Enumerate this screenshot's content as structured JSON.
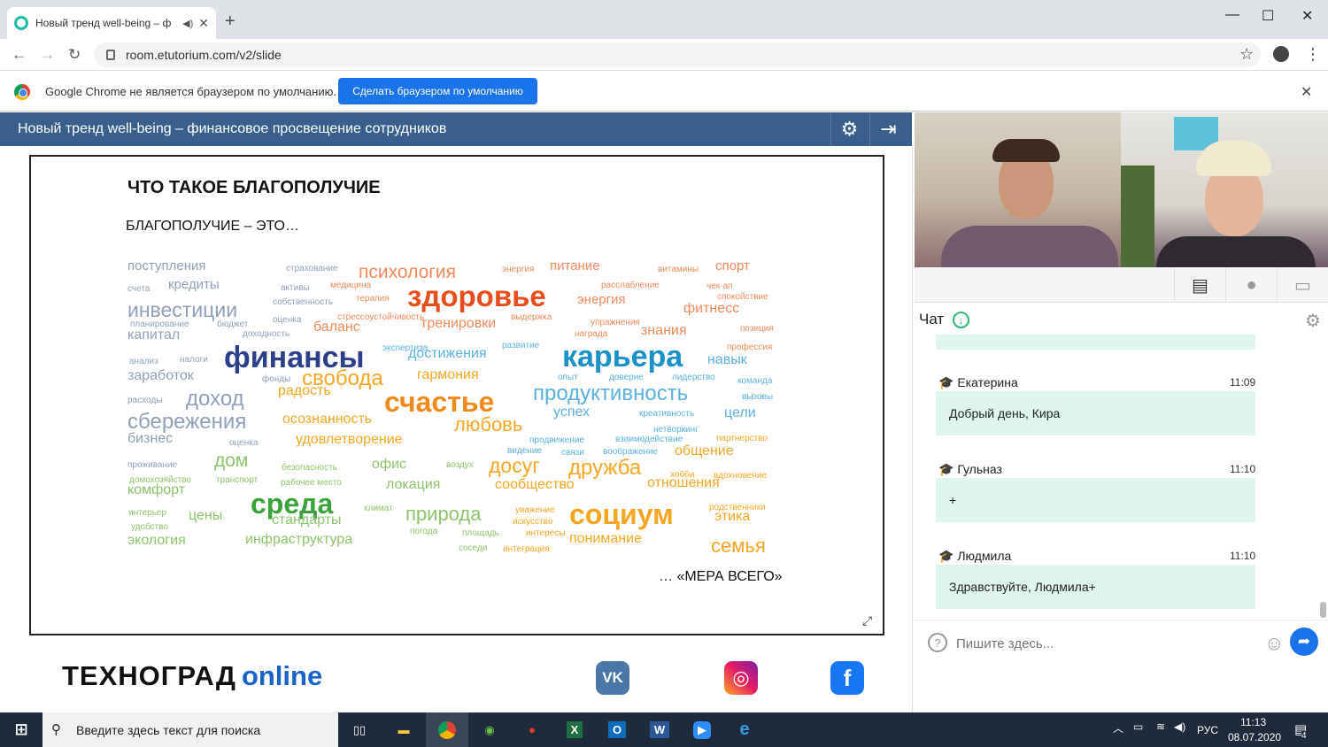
{
  "browser": {
    "tab_title": "Новый тренд well-being – ф",
    "url": "room.etutorium.com/v2/slide",
    "new_tab": "+",
    "minimize": "—",
    "maximize": "☐",
    "close": "✕",
    "back": "←",
    "forward": "→",
    "reload": "↻",
    "star": "☆",
    "menu": "⋮"
  },
  "infobar": {
    "text": "Google Chrome не является браузером по умолчанию.",
    "button": "Сделать браузером по умолчанию",
    "close": "✕"
  },
  "webinar": {
    "title": "Новый тренд well-being – финансовое просвещение сотрудников"
  },
  "slide": {
    "title": "ЧТО ТАКОЕ БЛАГОПОЛУЧИЕ",
    "subtitle": "БЛАГОПОЛУЧИЕ – ЭТО…",
    "footer": "… «МЕРА ВСЕГО»",
    "words": [
      [
        "поступления",
        144,
        293,
        15,
        "#8fa0b8"
      ],
      [
        "страхование",
        323,
        299,
        10,
        "#8fa0b8"
      ],
      [
        "психология",
        405,
        297,
        21,
        "#f08a5b"
      ],
      [
        "энергия",
        567,
        300,
        10,
        "#f08a5b"
      ],
      [
        "питание",
        621,
        293,
        15,
        "#f08a5b"
      ],
      [
        "витамины",
        743,
        300,
        10,
        "#f08a5b"
      ],
      [
        "спорт",
        808,
        293,
        15,
        "#f08a5b"
      ],
      [
        "счета",
        144,
        322,
        10,
        "#8fa0b8"
      ],
      [
        "кредиты",
        190,
        314,
        15,
        "#8fa0b8"
      ],
      [
        "активы",
        317,
        321,
        10,
        "#8fa0b8"
      ],
      [
        "медицина",
        373,
        318,
        10,
        "#f08a5b"
      ],
      [
        "расслабление",
        679,
        318,
        10,
        "#f08a5b"
      ],
      [
        "чек-ап",
        798,
        319,
        10,
        "#f08a5b"
      ],
      [
        "здоровье",
        460,
        318,
        33,
        "#e84e1b"
      ],
      [
        "собственность",
        308,
        337,
        10,
        "#8fa0b8"
      ],
      [
        "терапия",
        402,
        333,
        10,
        "#f08a5b"
      ],
      [
        "энергия",
        652,
        331,
        15,
        "#f08a5b"
      ],
      [
        "спокойствие",
        810,
        331,
        10,
        "#f08a5b"
      ],
      [
        "инвестиции",
        144,
        339,
        23,
        "#8fa0b8"
      ],
      [
        "фитнесс",
        772,
        341,
        16,
        "#f08a5b"
      ],
      [
        "стрессоустойчивость",
        381,
        354,
        10,
        "#f08a5b"
      ],
      [
        "выдержка",
        577,
        354,
        10,
        "#f08a5b"
      ],
      [
        "оценка",
        308,
        357,
        10,
        "#8fa0b8"
      ],
      [
        "планирование",
        147,
        362,
        10,
        "#8fa0b8"
      ],
      [
        "бюджет",
        245,
        362,
        10,
        "#8fa0b8"
      ],
      [
        "баланс",
        354,
        362,
        16,
        "#f08a5b"
      ],
      [
        "тренировки",
        475,
        358,
        16,
        "#f08a5b"
      ],
      [
        "упражнения",
        667,
        360,
        10,
        "#f08a5b"
      ],
      [
        "позиция",
        836,
        367,
        10,
        "#f08a5b"
      ],
      [
        "капитал",
        144,
        371,
        16,
        "#8fa0b8"
      ],
      [
        "доходность",
        274,
        373,
        10,
        "#8fa0b8"
      ],
      [
        "награда",
        649,
        373,
        10,
        "#f08a5b"
      ],
      [
        "знания",
        724,
        366,
        16,
        "#f08a5b"
      ],
      [
        "экспертиза",
        432,
        389,
        10,
        "#5bb0e0"
      ],
      [
        "развитие",
        567,
        386,
        10,
        "#5bb0e0"
      ],
      [
        "профессия",
        821,
        388,
        10,
        "#f08a5b"
      ],
      [
        "финансы",
        253,
        387,
        34,
        "#2c3e8c"
      ],
      [
        "достижения",
        461,
        392,
        16,
        "#5bb0e0"
      ],
      [
        "карьера",
        635,
        386,
        34,
        "#1a91c9"
      ],
      [
        "навык",
        799,
        399,
        16,
        "#5bb0e0"
      ],
      [
        "анализ",
        146,
        404,
        10,
        "#8fa0b8"
      ],
      [
        "налоги",
        203,
        402,
        10,
        "#8fa0b8"
      ],
      [
        "заработок",
        144,
        417,
        16,
        "#8fa0b8"
      ],
      [
        "фонды",
        296,
        424,
        10,
        "#8fa0b8"
      ],
      [
        "свобода",
        341,
        416,
        24,
        "#f5a623"
      ],
      [
        "гармония",
        471,
        416,
        16,
        "#f5a623"
      ],
      [
        "опыт",
        630,
        422,
        10,
        "#5bb0e0"
      ],
      [
        "доверие",
        688,
        422,
        10,
        "#5bb0e0"
      ],
      [
        "лидерство",
        759,
        422,
        10,
        "#5bb0e0"
      ],
      [
        "команда",
        833,
        426,
        10,
        "#5bb0e0"
      ],
      [
        "радость",
        314,
        434,
        16,
        "#f5a623"
      ],
      [
        "продуктивность",
        602,
        433,
        24,
        "#5bb0e0"
      ],
      [
        "расходы",
        144,
        448,
        10,
        "#8fa0b8"
      ],
      [
        "доход",
        210,
        439,
        24,
        "#8fa0b8"
      ],
      [
        "счастье",
        434,
        438,
        32,
        "#f08a1b"
      ],
      [
        "вызовы",
        838,
        444,
        10,
        "#5bb0e0"
      ],
      [
        "успех",
        625,
        458,
        16,
        "#5bb0e0"
      ],
      [
        "креативность",
        722,
        463,
        10,
        "#5bb0e0"
      ],
      [
        "цели",
        818,
        459,
        16,
        "#5bb0e0"
      ],
      [
        "сбережения",
        144,
        465,
        24,
        "#8fa0b8"
      ],
      [
        "осознанность",
        319,
        466,
        16,
        "#f5a623"
      ],
      [
        "любовь",
        513,
        469,
        22,
        "#f5a623"
      ],
      [
        "нетворкинг",
        738,
        481,
        10,
        "#5bb0e0"
      ],
      [
        "бизнес",
        144,
        488,
        16,
        "#8fa0b8"
      ],
      [
        "удовлетворение",
        334,
        489,
        16,
        "#f5a623"
      ],
      [
        "продвижение",
        598,
        493,
        10,
        "#5bb0e0"
      ],
      [
        "взаимодействие",
        695,
        492,
        10,
        "#5bb0e0"
      ],
      [
        "партнерство",
        809,
        491,
        10,
        "#f5a623"
      ],
      [
        "оценка",
        259,
        496,
        10,
        "#8fa0b8"
      ],
      [
        "видение",
        573,
        505,
        10,
        "#5bb0e0"
      ],
      [
        "связи",
        634,
        507,
        10,
        "#5bb0e0"
      ],
      [
        "воображение",
        681,
        506,
        10,
        "#5bb0e0"
      ],
      [
        "общение",
        762,
        502,
        16,
        "#f5a623"
      ],
      [
        "проживание",
        144,
        521,
        10,
        "#8fa0b8"
      ],
      [
        "дом",
        242,
        510,
        21,
        "#8ec26b"
      ],
      [
        "офис",
        420,
        517,
        16,
        "#8ec26b"
      ],
      [
        "безопасность",
        318,
        524,
        10,
        "#8ec26b"
      ],
      [
        "воздух",
        504,
        521,
        10,
        "#8ec26b"
      ],
      [
        "досуг",
        552,
        515,
        23,
        "#f5a623"
      ],
      [
        "дружба",
        642,
        517,
        24,
        "#f5a623"
      ],
      [
        "хобби",
        757,
        532,
        10,
        "#f5a623"
      ],
      [
        "вдохновение",
        806,
        533,
        10,
        "#f5a623"
      ],
      [
        "домохозяйство",
        146,
        538,
        10,
        "#8ec26b"
      ],
      [
        "транспорт",
        244,
        538,
        10,
        "#8ec26b"
      ],
      [
        "рабочее место",
        317,
        541,
        10,
        "#8ec26b"
      ],
      [
        "локация",
        436,
        540,
        16,
        "#8ec26b"
      ],
      [
        "сообщество",
        559,
        540,
        16,
        "#f5a623"
      ],
      [
        "отношения",
        731,
        538,
        16,
        "#f5a623"
      ],
      [
        "комфорт",
        144,
        546,
        16,
        "#8ec26b"
      ],
      [
        "среда",
        283,
        553,
        32,
        "#3ca33c"
      ],
      [
        "климат",
        411,
        570,
        10,
        "#8ec26b"
      ],
      [
        "природа",
        458,
        570,
        22,
        "#8ec26b"
      ],
      [
        "уважение",
        582,
        572,
        10,
        "#f5a623"
      ],
      [
        "социум",
        643,
        565,
        32,
        "#f5a623"
      ],
      [
        "родственники",
        801,
        569,
        10,
        "#f5a623"
      ],
      [
        "интерьер",
        145,
        575,
        10,
        "#8ec26b"
      ],
      [
        "цены",
        213,
        575,
        16,
        "#8ec26b"
      ],
      [
        "стандарты",
        307,
        580,
        16,
        "#8ec26b"
      ],
      [
        "искусство",
        579,
        585,
        10,
        "#f5a623"
      ],
      [
        "этика",
        807,
        576,
        16,
        "#f5a623"
      ],
      [
        "удобство",
        148,
        591,
        10,
        "#8ec26b"
      ],
      [
        "погода",
        463,
        596,
        10,
        "#8ec26b"
      ],
      [
        "площадь",
        522,
        598,
        10,
        "#8ec26b"
      ],
      [
        "интересы",
        594,
        598,
        10,
        "#f5a623"
      ],
      [
        "экология",
        144,
        603,
        16,
        "#8ec26b"
      ],
      [
        "инфраструктура",
        277,
        602,
        16,
        "#8ec26b"
      ],
      [
        "понимание",
        643,
        601,
        16,
        "#f5a623"
      ],
      [
        "семья",
        803,
        606,
        22,
        "#f5a623"
      ],
      [
        "соседи",
        518,
        615,
        10,
        "#8ec26b"
      ],
      [
        "интеграция",
        568,
        616,
        10,
        "#f5a623"
      ]
    ]
  },
  "brand": {
    "logo_text": "ТЕХНОГРАД",
    "logo_online": "online"
  },
  "social": {
    "vk": "VK",
    "instagram": "◎",
    "facebook": "f"
  },
  "chat": {
    "label": "Чат",
    "input_placeholder": "Пишите здесь...",
    "messages": [
      {
        "name": "Екатерина",
        "time": "11:09",
        "text": "Добрый день, Кира"
      },
      {
        "name": "Гульназ",
        "time": "11:10",
        "text": "+"
      },
      {
        "name": "Людмила",
        "time": "11:10",
        "text": "Здравствуйте, Людмила+"
      }
    ]
  },
  "taskbar": {
    "search_placeholder": "Введите здесь текст для поиска",
    "lang": "РУС",
    "time": "11:13",
    "date": "08.07.2020",
    "notif": "4"
  }
}
